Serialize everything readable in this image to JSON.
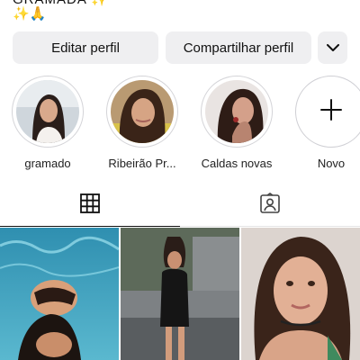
{
  "bio": {
    "line1": "GRAMADA ✨",
    "line2": "✨🙏"
  },
  "buttons": {
    "edit_profile": "Editar perfil",
    "share_profile": "Compartilhar perfil",
    "more": "chevron-down-icon"
  },
  "highlights": [
    {
      "label": "gramado"
    },
    {
      "label": "Ribeirão Pr..."
    },
    {
      "label": "Caldas novas"
    },
    {
      "label": "Novo",
      "icon": "plus-icon"
    }
  ],
  "tabs": [
    {
      "icon": "grid-icon",
      "selected": true
    },
    {
      "icon": "tagged-person-icon",
      "selected": false
    }
  ],
  "posts": [
    {
      "icon": "photo-pool"
    },
    {
      "icon": "photo-street"
    },
    {
      "icon": "photo-portrait"
    }
  ],
  "colors": {
    "button_bg": "#efeff1",
    "text": "#111111",
    "ring": "#d4d4d8"
  }
}
